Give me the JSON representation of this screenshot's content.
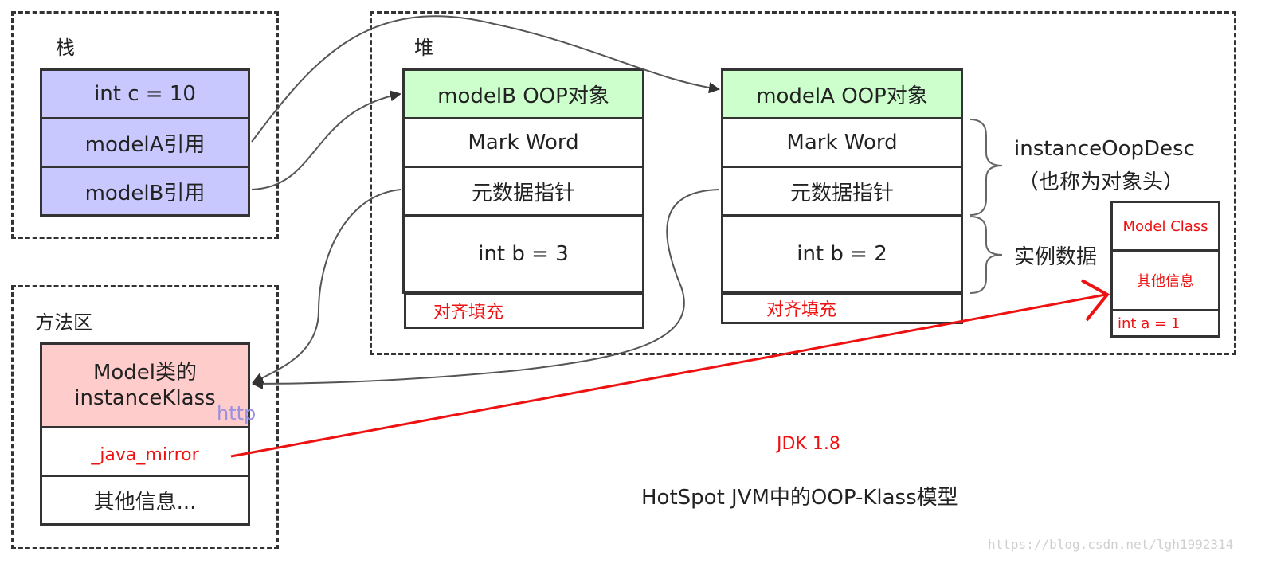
{
  "regions": {
    "stack": "栈",
    "heap": "堆",
    "method_area": "方法区"
  },
  "stack": {
    "rows": [
      "int c = 10",
      "modelA引用",
      "modelB引用"
    ]
  },
  "heap": {
    "modelB": {
      "header": "modelB OOP对象",
      "mark_word": "Mark Word",
      "metadata_pointer": "元数据指针",
      "field": "int b = 3",
      "padding": "对齐填充"
    },
    "modelA": {
      "header": "modelA OOP对象",
      "mark_word": "Mark Word",
      "metadata_pointer": "元数据指针",
      "field": "int b = 2",
      "padding": "对齐填充"
    },
    "labels": {
      "instance_oop_desc": "instanceOopDesc",
      "object_header": "（也称为对象头）",
      "instance_data": "实例数据"
    }
  },
  "mirror_class": {
    "title": "Model Class",
    "other": "其他信息",
    "field": "int a = 1"
  },
  "method_area": {
    "klass": "Model类的\ninstanceKlass",
    "java_mirror": "_java_mirror",
    "other": "其他信息..."
  },
  "captions": {
    "jdk": "JDK 1.8",
    "title": "HotSpot JVM中的OOP-Klass模型",
    "watermark": "https://blog.csdn.net/lgh1992314",
    "watermark_fragment": "http"
  },
  "colors": {
    "stack_fill": "#c8c8ff",
    "header_fill": "#ccffcc",
    "klass_fill": "#ffcccc",
    "accent_red": "#ee1111"
  }
}
